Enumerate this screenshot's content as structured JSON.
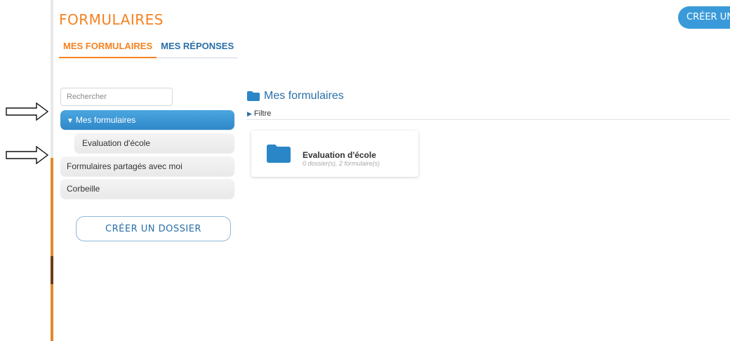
{
  "header": {
    "app_title": "FORMULAIRES",
    "create_button_label": "CRÉER UN"
  },
  "tabs": [
    {
      "label": "MES FORMULAIRES",
      "active": true
    },
    {
      "label": "MES RÉPONSES",
      "active": false
    }
  ],
  "sidebar": {
    "search_placeholder": "Rechercher",
    "items": [
      {
        "label": "Mes formulaires",
        "active": true,
        "expanded": true
      },
      {
        "label": "Evaluation d'école",
        "active": false
      },
      {
        "label": "Formulaires partagés avec moi",
        "active": false
      },
      {
        "label": "Corbeille",
        "active": false
      }
    ],
    "create_folder_label": "CRÉER UN DOSSIER"
  },
  "main": {
    "title": "Mes formulaires",
    "filter_label": "Filtre",
    "folders": [
      {
        "name": "Evaluation d'école",
        "meta": "0 dossier(s), 2 formulaire(s)"
      }
    ]
  },
  "colors": {
    "accent_orange": "#f58220",
    "accent_blue": "#3a9ad9",
    "link_blue": "#2a6fa8"
  },
  "icons": {
    "caret": "caret-down-icon",
    "filter": "triangle-right-icon",
    "folder": "folder-icon",
    "annotation": "arrow-right-outline-icon"
  }
}
